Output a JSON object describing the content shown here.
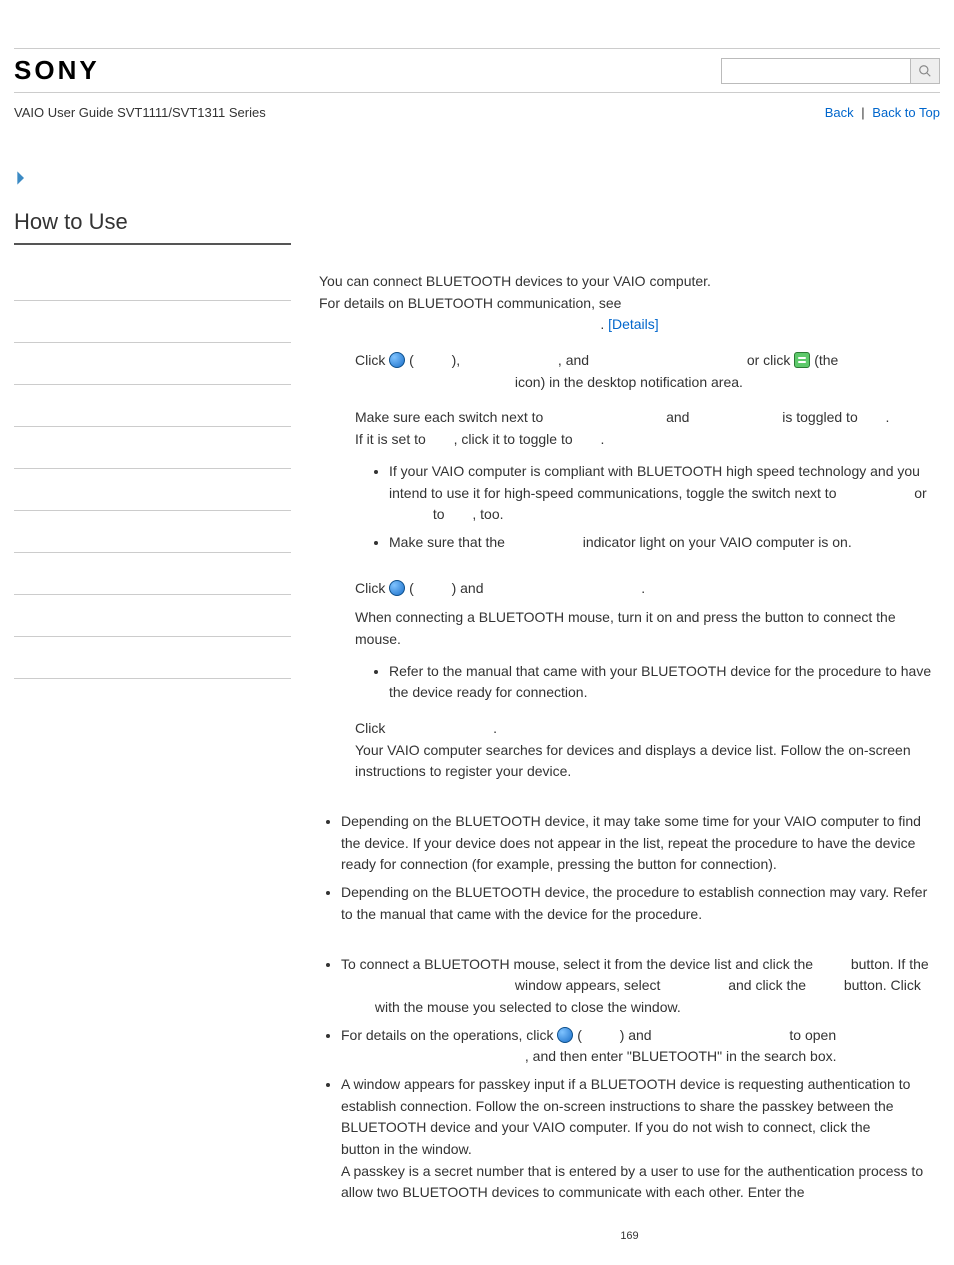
{
  "header": {
    "logo": "SONY",
    "guide": "VAIO User Guide SVT1111/SVT1311 Series",
    "back": "Back",
    "backTop": "Back to Top",
    "searchPlaceholder": ""
  },
  "sidebar": {
    "title": "How to Use",
    "items": [
      "",
      "",
      "",
      "",
      "",
      "",
      "",
      "",
      "",
      ""
    ]
  },
  "content": {
    "intro1": "You can connect BLUETOOTH devices to your VAIO computer.",
    "intro2_a": "For details on BLUETOOTH communication, see ",
    "intro2_b": ". ",
    "detailsLink": "[Details]",
    "step1_a": "Click ",
    "step1_b": " (",
    "step1_c": "), ",
    "step1_d": ", and ",
    "step1_e": " or click ",
    "step1_f": " (the ",
    "step1_g": " icon) in the desktop notification area.",
    "step2_a": "Make sure each switch next to ",
    "step2_b": " and ",
    "step2_c": " is toggled to ",
    "step2_d": ".",
    "step2_e": "If it is set to ",
    "step2_f": ", click it to toggle to ",
    "step2_g": ".",
    "step2_bul1_a": "If your VAIO computer is compliant with BLUETOOTH high speed technology and you intend to use it for high-speed communications, toggle the switch next to ",
    "step2_bul1_b": " or ",
    "step2_bul1_c": " to ",
    "step2_bul1_d": ", too.",
    "step2_bul2_a": "Make sure that the ",
    "step2_bul2_b": " indicator light on your VAIO computer is on.",
    "step3_a": "Click ",
    "step3_b": " (",
    "step3_c": ") and ",
    "step3_d": ".",
    "step3_e": "When connecting a BLUETOOTH mouse, turn it on and press the button to connect the mouse.",
    "step3_bul1": "Refer to the manual that came with your BLUETOOTH device for the procedure to have the device ready for connection.",
    "step4_a": "Click ",
    "step4_b": ".",
    "step4_c": "Your VAIO computer searches for devices and displays a device list. Follow the on-screen instructions to register your device.",
    "sectA_b1": "Depending on the BLUETOOTH device, it may take some time for your VAIO computer to find the device. If your device does not appear in the list, repeat the procedure to have the device ready for connection (for example, pressing the button for connection).",
    "sectA_b2": "Depending on the BLUETOOTH device, the procedure to establish connection may vary. Refer to the manual that came with the device for the procedure.",
    "sectB_b1_a": "To connect a BLUETOOTH mouse, select it from the device list and click the ",
    "sectB_b1_b": " button. If the ",
    "sectB_b1_c": " window appears, select ",
    "sectB_b1_d": " and click the ",
    "sectB_b1_e": " button. Click ",
    "sectB_b1_f": " with the mouse you selected to close the window.",
    "sectB_b2_a": "For details on the operations, click ",
    "sectB_b2_b": " (",
    "sectB_b2_c": ") and ",
    "sectB_b2_d": " to open ",
    "sectB_b2_e": ", and then enter \"BLUETOOTH\" in the search box.",
    "sectB_b3_a": "A window appears for passkey input if a BLUETOOTH device is requesting authentication to establish connection. Follow the on-screen instructions to share the passkey between the BLUETOOTH device and your VAIO computer. If you do not wish to connect, click the ",
    "sectB_b3_b": " button in the window.",
    "sectB_b3_c": "A passkey is a secret number that is entered by a user to use for the authentication process to allow two BLUETOOTH devices to communicate with each other. Enter the",
    "pageNum": "169"
  }
}
